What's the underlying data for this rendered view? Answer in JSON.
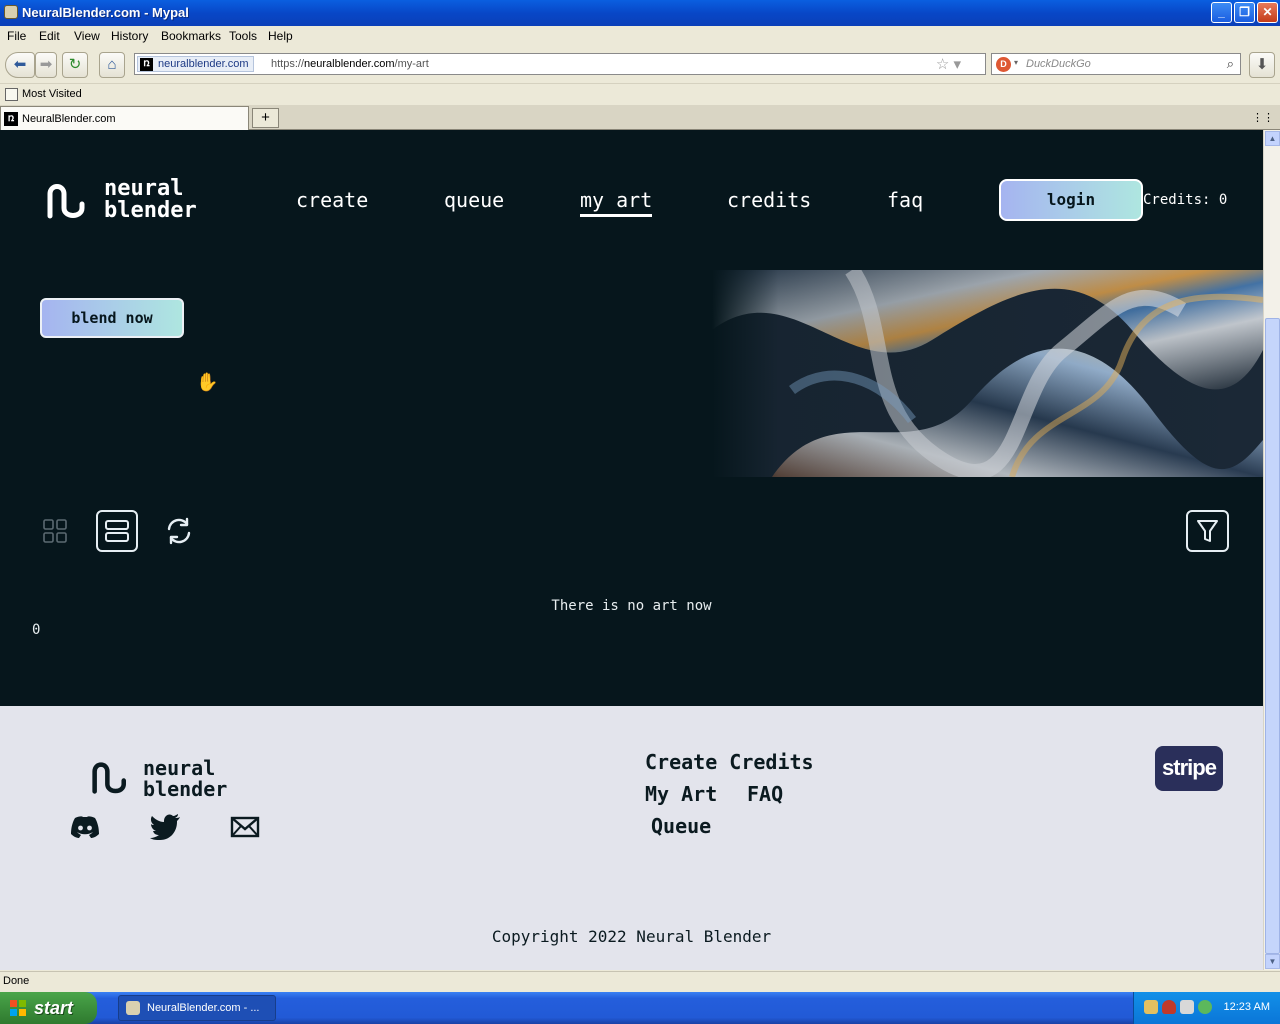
{
  "window": {
    "title": "NeuralBlender.com - Mypal"
  },
  "menu": [
    "File",
    "Edit",
    "View",
    "History",
    "Bookmarks",
    "Tools",
    "Help"
  ],
  "browser": {
    "site_identity": "neuralblender.com",
    "url_prefix": "https://",
    "url_host": "neuralblender.com",
    "url_path": "/my-art",
    "search_placeholder": "DuckDuckGo",
    "bookmarks_item": "Most Visited",
    "tab_title": "NeuralBlender.com",
    "new_tab": "+",
    "status": "Done"
  },
  "site": {
    "logo_line1": "neural",
    "logo_line2": "blender",
    "nav": {
      "create": "create",
      "queue": "queue",
      "my_art": "my art",
      "credits": "credits",
      "faq": "faq"
    },
    "login": "login",
    "credits_label": "Credits: 0",
    "blend_now": "blend now",
    "empty_message": "There is no art now",
    "art_count": "0"
  },
  "footer": {
    "logo_line1": "neural",
    "logo_line2": "blender",
    "links": {
      "create_credits": "Create Credits",
      "my_art": "My Art",
      "faq": "FAQ",
      "queue": "Queue"
    },
    "stripe": "stripe",
    "copyright": "Copyright 2022 Neural Blender"
  },
  "taskbar": {
    "start": "start",
    "task_item": "NeuralBlender.com - ...",
    "clock": "12:23 AM"
  },
  "colors": {
    "page_bg": "#06161c",
    "footer_bg": "#e3e4ec",
    "button_gradient_start": "#a5b4f0",
    "button_gradient_end": "#aee6e0"
  }
}
